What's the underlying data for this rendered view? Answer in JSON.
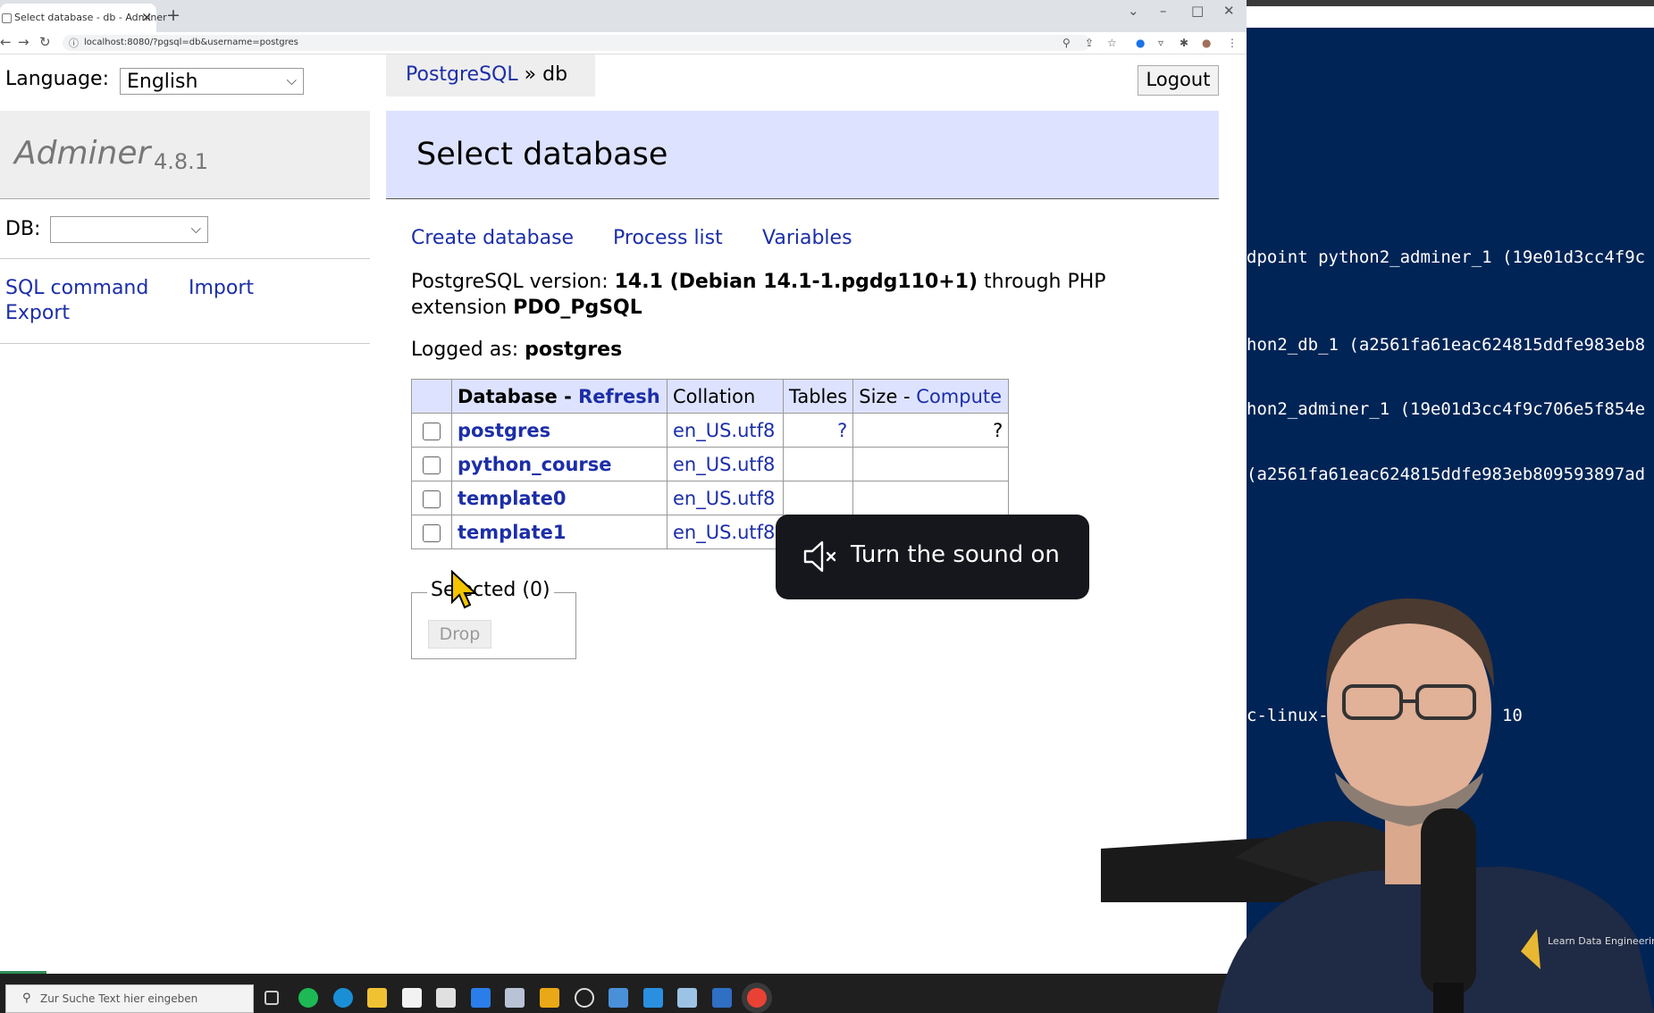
{
  "browser": {
    "tab_title": "Select database - db - Adminer",
    "url": "localhost:8080/?pgsql=db&username=postgres"
  },
  "language": {
    "label": "Language:",
    "selected": "English"
  },
  "breadcrumb": {
    "system": "PostgreSQL",
    "separator": "»",
    "db": "db"
  },
  "logout_label": "Logout",
  "brand": {
    "name": "Adminer",
    "version": "4.8.1"
  },
  "db_label": "DB:",
  "sidebar_links": {
    "sql_command": "SQL command",
    "import": "Import",
    "export": "Export"
  },
  "heading": "Select database",
  "menu": {
    "create": "Create database",
    "process": "Process list",
    "variables": "Variables"
  },
  "version_info": {
    "prefix": "PostgreSQL version:",
    "version": "14.1 (Debian 14.1-1.pgdg110+1)",
    "through": "through PHP",
    "ext_prefix": "extension",
    "extension": "PDO_PgSQL"
  },
  "logged": {
    "prefix": "Logged as:",
    "user": "postgres"
  },
  "table": {
    "header": {
      "database": "Database",
      "dash": " - ",
      "refresh": "Refresh",
      "collation": "Collation",
      "tables": "Tables",
      "size": "Size",
      "compute": "Compute"
    },
    "rows": [
      {
        "name": "postgres",
        "collation": "en_US.utf8",
        "tables": "?",
        "size": "?"
      },
      {
        "name": "python_course",
        "collation": "en_US.utf8",
        "tables": "",
        "size": ""
      },
      {
        "name": "template0",
        "collation": "en_US.utf8",
        "tables": "",
        "size": ""
      },
      {
        "name": "template1",
        "collation": "en_US.utf8",
        "tables": "",
        "size": ""
      }
    ]
  },
  "selected": {
    "legend": "Selected (0)",
    "drop_label": "Drop"
  },
  "toast": {
    "text": "Turn the sound on"
  },
  "taskbar": {
    "search_placeholder": "Zur Suche Text hier eingeben"
  },
  "terminal": {
    "lines": [
      "dpoint python2_adminer_1 (19e01d3cc4f9c",
      "hon2_db_1 (a2561fa61eac624815ddfe983eb8",
      "hon2_adminer_1 (19e01d3cc4f9c706e5f854e",
      "(a2561fa61eac624815ddfe983eb809593897ad",
      "c-linux-gnu, comp         Debian 10"
    ]
  },
  "webcam": {
    "logo_text": "Learn Data Engineering"
  },
  "colors": {
    "link": "#1c2ea8",
    "header_bg": "#dde3ff",
    "terminal_bg": "#012456",
    "toast_bg": "#16161d"
  }
}
